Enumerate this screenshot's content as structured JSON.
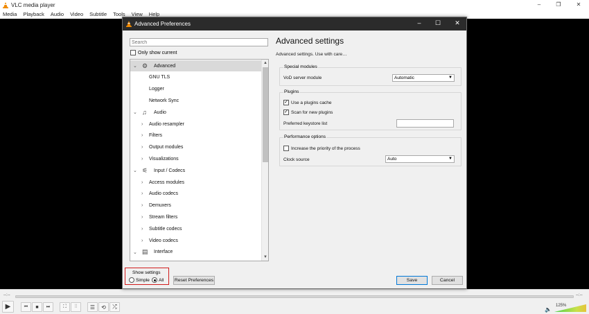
{
  "app": {
    "title": "VLC media player",
    "menu": [
      "Media",
      "Playback",
      "Audio",
      "Video",
      "Subtitle",
      "Tools",
      "View",
      "Help"
    ],
    "window_controls": [
      "–",
      "❐",
      "✕"
    ]
  },
  "player": {
    "time_left": "--:--",
    "time_right": "--:--",
    "volume_label": "125%",
    "volume_level_percent": 125,
    "icons": {
      "play": "play-icon",
      "previous": "previous-icon",
      "stop": "stop-icon",
      "next": "next-icon",
      "fullscreen": "fullscreen-icon",
      "extended": "equalizer-icon",
      "playlist": "playlist-icon",
      "loop": "loop-icon",
      "shuffle": "shuffle-icon",
      "volume": "speaker-icon"
    }
  },
  "dialog": {
    "title": "Advanced Preferences",
    "window_controls": [
      "–",
      "☐",
      "✕"
    ],
    "search_placeholder": "Search",
    "only_show_current": "Only show current",
    "tree": [
      {
        "label": "Advanced",
        "level": 0,
        "expanded": true,
        "selected": true,
        "icon": "gear-icon"
      },
      {
        "label": "GNU TLS",
        "level": 1
      },
      {
        "label": "Logger",
        "level": 1
      },
      {
        "label": "Network Sync",
        "level": 1
      },
      {
        "label": "Audio",
        "level": 0,
        "expanded": true,
        "icon": "music-note-icon"
      },
      {
        "label": "Audio resampler",
        "level": 1,
        "collapsed": true
      },
      {
        "label": "Filters",
        "level": 1,
        "collapsed": true
      },
      {
        "label": "Output modules",
        "level": 1,
        "collapsed": true
      },
      {
        "label": "Visualizations",
        "level": 1,
        "collapsed": true
      },
      {
        "label": "Input / Codecs",
        "level": 0,
        "expanded": true,
        "icon": "codecs-icon"
      },
      {
        "label": "Access modules",
        "level": 1,
        "collapsed": true
      },
      {
        "label": "Audio codecs",
        "level": 1,
        "collapsed": true
      },
      {
        "label": "Demuxers",
        "level": 1,
        "collapsed": true
      },
      {
        "label": "Stream filters",
        "level": 1,
        "collapsed": true
      },
      {
        "label": "Subtitle codecs",
        "level": 1,
        "collapsed": true
      },
      {
        "label": "Video codecs",
        "level": 1,
        "collapsed": true
      },
      {
        "label": "Interface",
        "level": 0,
        "expanded": true,
        "icon": "interface-icon"
      }
    ],
    "show_settings": {
      "label": "Show settings",
      "simple": "Simple",
      "all": "All",
      "selected": "All"
    },
    "reset_label": "Reset Preferences",
    "save_label": "Save",
    "cancel_label": "Cancel",
    "panel": {
      "heading": "Advanced settings",
      "subheading": "Advanced settings. Use with care…",
      "special_modules": {
        "title": "Special modules",
        "vod_label": "VoD server module",
        "vod_value": "Automatic"
      },
      "plugins": {
        "title": "Plugins",
        "use_cache_label": "Use a plugins cache",
        "use_cache_checked": true,
        "scan_label": "Scan for new plugins",
        "scan_checked": true,
        "keystore_label": "Preferred keystore list",
        "keystore_value": ""
      },
      "performance": {
        "title": "Performance options",
        "priority_label": "Increase the priority of the process",
        "priority_checked": false,
        "clock_label": "Clock source",
        "clock_value": "Auto"
      }
    }
  }
}
